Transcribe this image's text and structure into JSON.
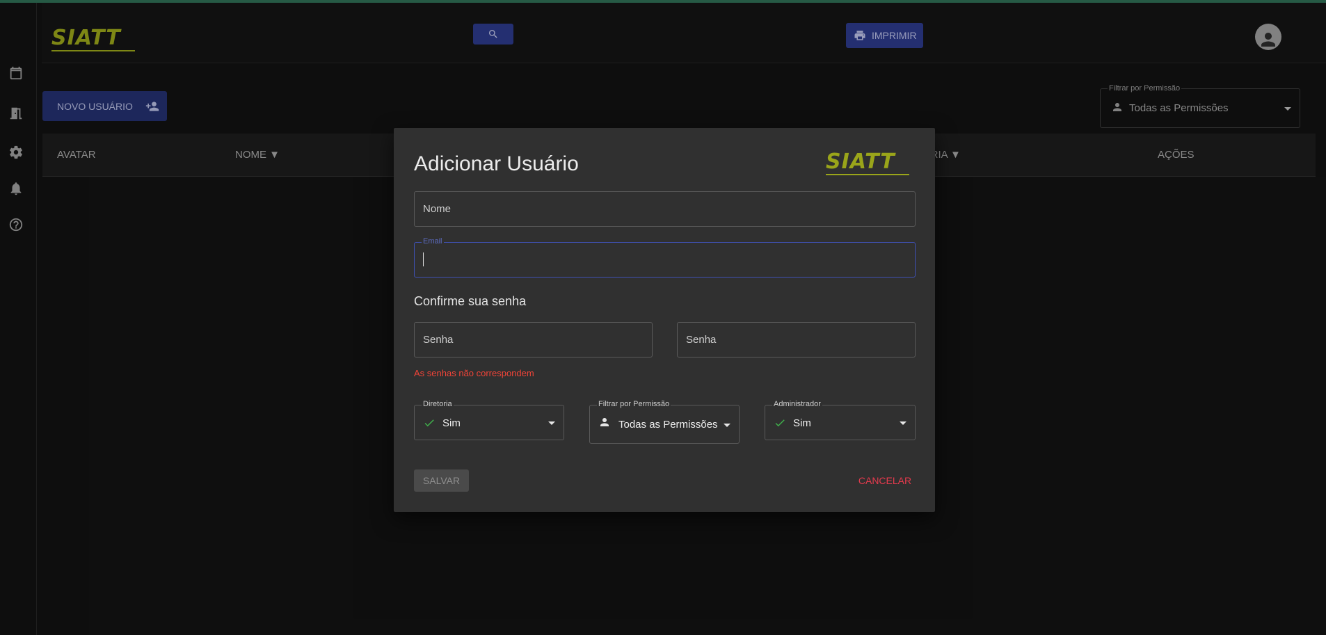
{
  "colors": {
    "accent": "#2d3a8a",
    "brand": "#9aa51a",
    "error": "#f04438",
    "cancel": "#e53a4d",
    "check": "#3fae4b"
  },
  "header": {
    "logo_text": "SIATT",
    "print_label": "IMPRIMIR"
  },
  "rail": {
    "icons": [
      "calendar-icon",
      "door-icon",
      "gear-icon",
      "bell-icon",
      "help-icon"
    ]
  },
  "toolbar": {
    "new_user_label": "NOVO USUÁRIO",
    "filter_legend": "Filtrar por Permissão",
    "filter_value": "Todas as Permissões"
  },
  "table": {
    "headers": [
      "AVATAR",
      "NOME ▼",
      "ORIA ▼",
      "AÇÕES"
    ]
  },
  "modal": {
    "title": "Adicionar Usuário",
    "logo_text": "SIATT",
    "name_placeholder": "Nome",
    "email_legend": "Email",
    "email_value": "",
    "confirm_title": "Confirme sua senha",
    "password_placeholder": "Senha",
    "password_confirm_placeholder": "Senha",
    "error": "As senhas não correspondem",
    "diretoria_legend": "Diretoria",
    "diretoria_value": "Sim",
    "permissao_legend": "Filtrar por Permissão",
    "permissao_value": "Todas as Permissões",
    "admin_legend": "Administrador",
    "admin_value": "Sim",
    "save_label": "SALVAR",
    "cancel_label": "CANCELAR"
  }
}
